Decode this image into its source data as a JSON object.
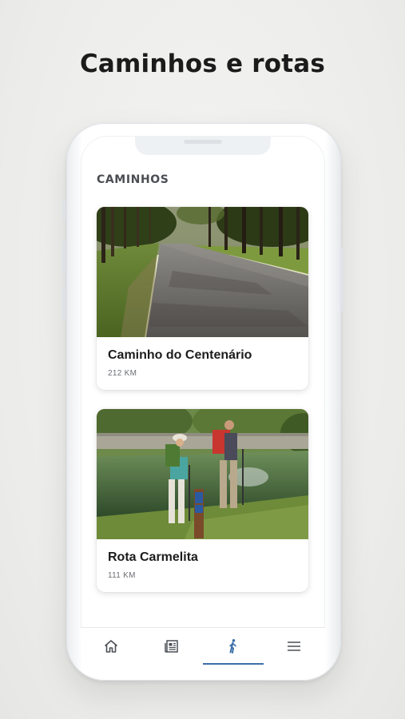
{
  "headline": "Caminhos e rotas",
  "screen": {
    "section_title": "CAMINHOS",
    "routes": [
      {
        "name": "Caminho do Centenário",
        "distance": "212 KM",
        "image": "forest-road-photo"
      },
      {
        "name": "Rota Carmelita",
        "distance": "111 KM",
        "image": "hikers-photo"
      }
    ]
  },
  "tabbar": {
    "tabs": [
      {
        "icon": "home-icon",
        "active": false
      },
      {
        "icon": "newspaper-icon",
        "active": false
      },
      {
        "icon": "hiker-icon",
        "active": true
      },
      {
        "icon": "menu-icon",
        "active": false
      }
    ]
  },
  "colors": {
    "accent": "#3c6fa8",
    "background": "#ececea",
    "title": "#1b1b1b",
    "section_title": "#4a4d52"
  }
}
